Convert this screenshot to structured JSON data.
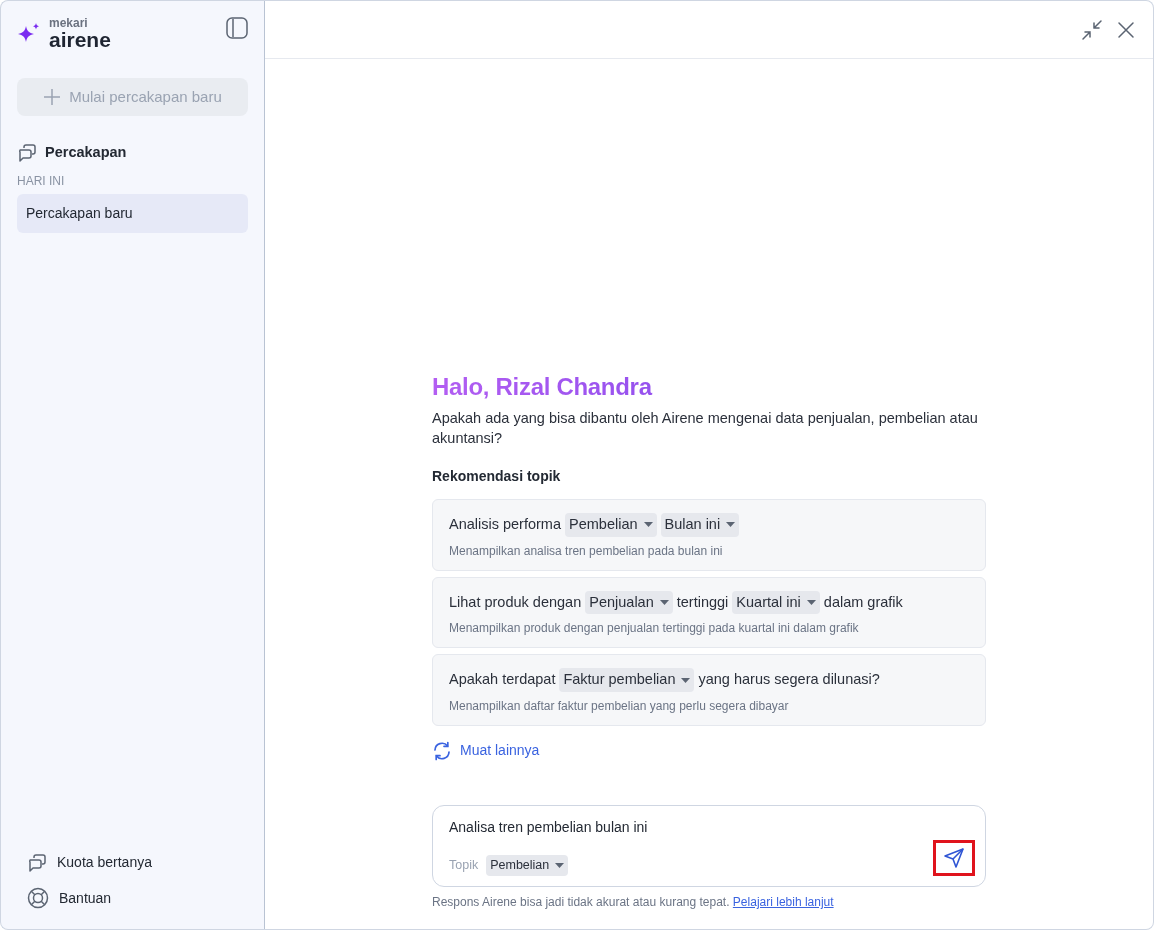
{
  "sidebar": {
    "brand_small": "mekari",
    "brand": "airene",
    "new_chat_button": {
      "label": "Mulai percakapan baru",
      "disabled": true
    },
    "section_title": "Percakapan",
    "group_label": "HARI INI",
    "conversations": [
      {
        "label": "Percakapan baru",
        "selected": true
      }
    ],
    "footer_items": [
      {
        "kind": "quota",
        "label": "Kuota bertanya"
      },
      {
        "kind": "help",
        "label": "Bantuan"
      }
    ]
  },
  "greeting": "Halo, Rizal Chandra",
  "intro": "Apakah ada yang bisa dibantu oleh Airene mengenai data penjualan, pembelian atau akuntansi?",
  "recommendations_title": "Rekomendasi topik",
  "recommendations": [
    {
      "parts": [
        {
          "kind": "text",
          "text": "Analisis performa"
        },
        {
          "kind": "chip",
          "text": "Pembelian"
        },
        {
          "kind": "chip",
          "text": "Bulan ini"
        }
      ],
      "description": "Menampilkan analisa tren pembelian pada bulan ini"
    },
    {
      "parts": [
        {
          "kind": "text",
          "text": "Lihat produk dengan"
        },
        {
          "kind": "chip",
          "text": "Penjualan"
        },
        {
          "kind": "text",
          "text": "tertinggi"
        },
        {
          "kind": "chip",
          "text": "Kuartal ini"
        },
        {
          "kind": "text",
          "text": "dalam grafik"
        }
      ],
      "description": "Menampilkan produk dengan penjualan tertinggi pada kuartal ini dalam grafik"
    },
    {
      "parts": [
        {
          "kind": "text",
          "text": "Apakah terdapat"
        },
        {
          "kind": "chip",
          "text": "Faktur pembelian"
        },
        {
          "kind": "text",
          "text": "yang harus segera dilunasi?"
        }
      ],
      "description": "Menampilkan daftar faktur pembelian yang perlu segera dibayar"
    }
  ],
  "load_more": "Muat lainnya",
  "composer": {
    "value": "Analisa tren pembelian bulan ini",
    "topic_label": "Topik",
    "topic": "Pembelian",
    "send_highlighted": true
  },
  "disclaimer": "Respons Airene bisa jadi tidak akurat atau kurang tepat.",
  "disclaimer_link": "Pelajari lebih lanjut"
}
